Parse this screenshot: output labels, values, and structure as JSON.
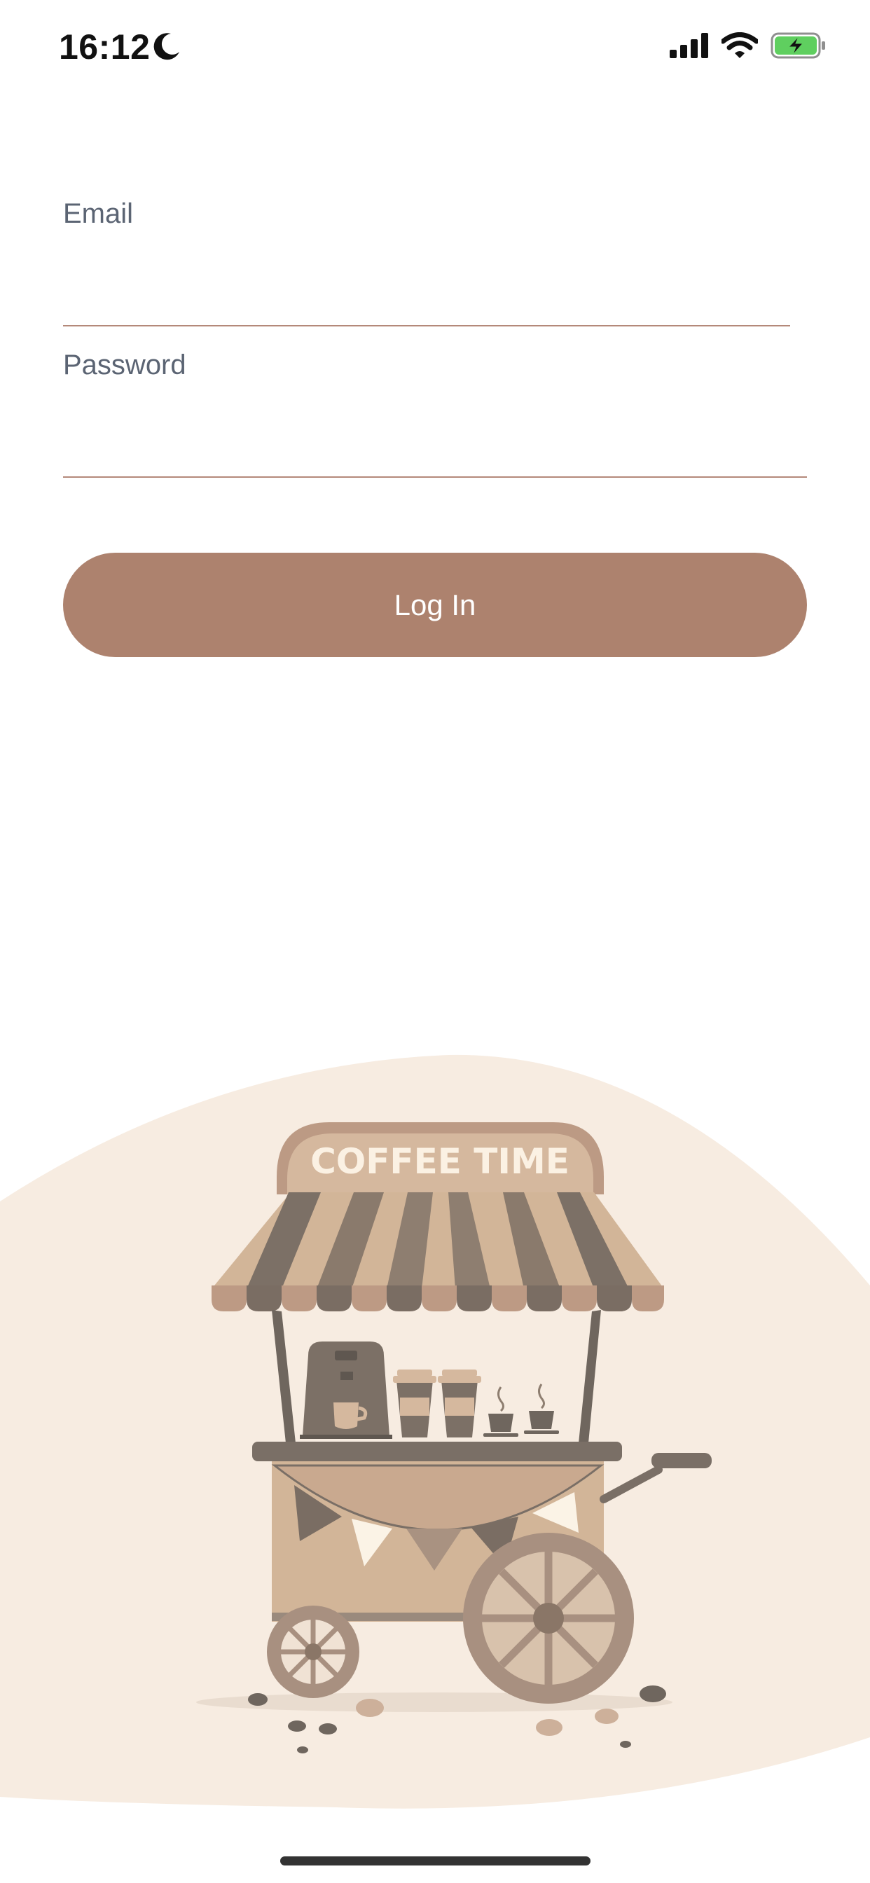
{
  "status_bar": {
    "time": "16:12",
    "icons": [
      "moon-icon",
      "cellular-signal-icon",
      "wifi-icon",
      "battery-charging-icon"
    ],
    "battery_color": "#5fcf5f"
  },
  "form": {
    "email_label": "Email",
    "email_value": "",
    "password_label": "Password",
    "password_value": "",
    "login_label": "Log In"
  },
  "illustration": {
    "sign_text": "COFFEE TIME"
  },
  "colors": {
    "accent": "#ad826e",
    "field_line": "#b4897a",
    "label_text": "#5b6473",
    "blob_background": "#f7ece1"
  }
}
